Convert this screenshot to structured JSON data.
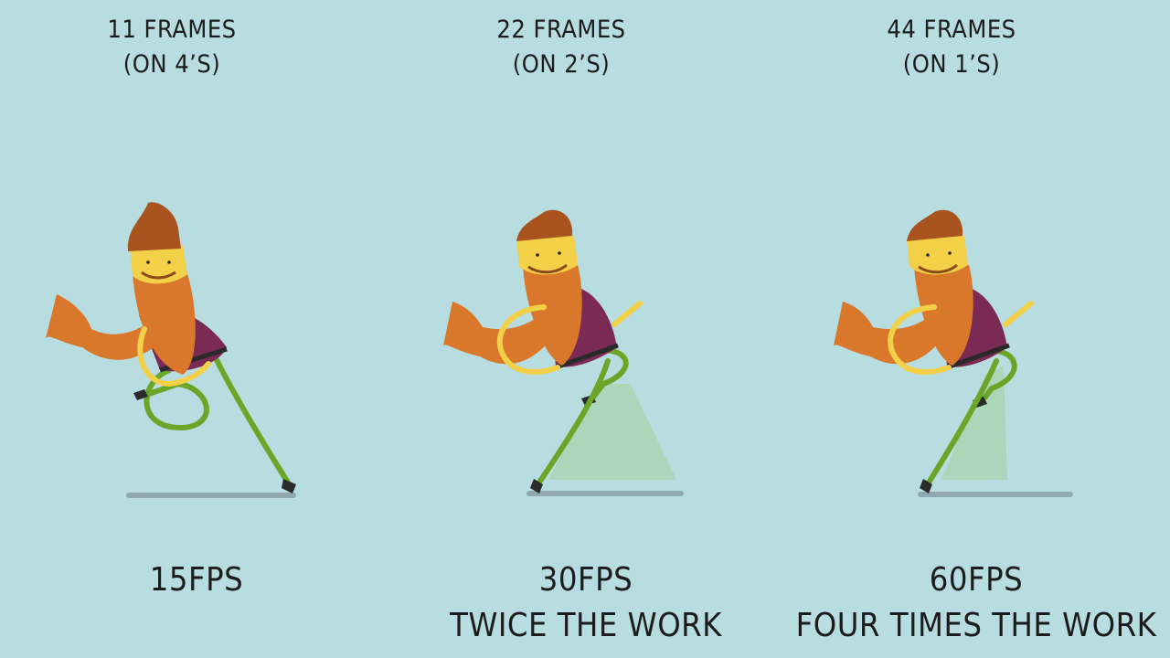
{
  "panels": [
    {
      "top_line1": "11 FRAMES",
      "top_line2": "(ON 4’S)",
      "bottom_line1": "15FPS",
      "bottom_line2": ""
    },
    {
      "top_line1": "22 FRAMES",
      "top_line2": "(ON 2’S)",
      "bottom_line1": "30FPS",
      "bottom_line2": "TWICE THE WORK"
    },
    {
      "top_line1": "44 FRAMES",
      "top_line2": "(ON 1’S)",
      "bottom_line1": "60FPS",
      "bottom_line2": "FOUR TIMES THE WORK"
    }
  ],
  "colors": {
    "background": "#b8dde0",
    "skin_orange": "#d9782a",
    "hair_brown": "#a9531e",
    "face_yellow": "#f2d048",
    "shirt_purple": "#7a2a55",
    "leg_green": "#6aa628",
    "arm_yellow": "#f2d048",
    "shadow": "#8aa6ab"
  }
}
